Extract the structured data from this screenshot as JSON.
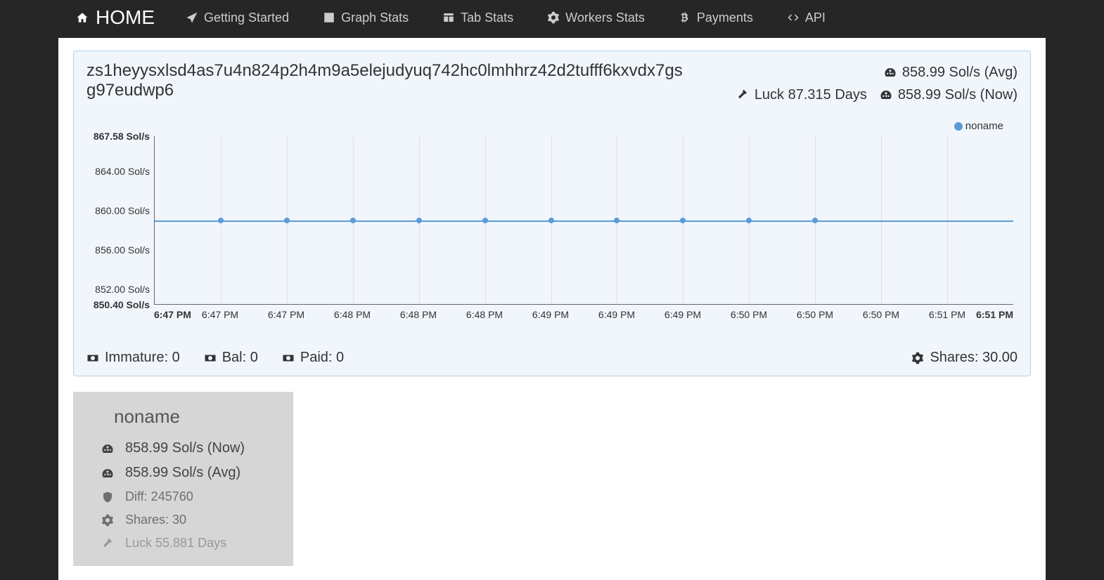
{
  "nav": {
    "home": "HOME",
    "items": [
      {
        "label": "Getting Started"
      },
      {
        "label": "Graph Stats"
      },
      {
        "label": "Tab Stats"
      },
      {
        "label": "Workers Stats"
      },
      {
        "label": "Payments"
      },
      {
        "label": "API"
      }
    ]
  },
  "panel": {
    "address": "zs1heyysxlsd4as7u4n824p2h4m9a5elejudyuq742hc0lmhhrz42d2tufff6kxvdx7gsg97eudwp6",
    "avg": "858.99 Sol/s (Avg)",
    "luck": "Luck 87.315 Days",
    "now": "858.99 Sol/s (Now)",
    "legend": "noname",
    "foot": {
      "immature": "Immature: 0",
      "bal": "Bal: 0",
      "paid": "Paid: 0",
      "shares": "Shares: 30.00"
    }
  },
  "worker": {
    "name": "noname",
    "now": "858.99 Sol/s (Now)",
    "avg": "858.99 Sol/s (Avg)",
    "diff": "Diff: 245760",
    "shares": "Shares: 30",
    "luck": "Luck 55.881 Days"
  },
  "chart_data": {
    "type": "line",
    "title": "",
    "xlabel": "",
    "ylabel": "",
    "ylim": [
      850.4,
      867.58
    ],
    "y_ticks": [
      {
        "label": "867.58 Sol/s",
        "value": 867.58,
        "bold": true
      },
      {
        "label": "864.00 Sol/s",
        "value": 864.0,
        "bold": false
      },
      {
        "label": "860.00 Sol/s",
        "value": 860.0,
        "bold": false
      },
      {
        "label": "856.00 Sol/s",
        "value": 856.0,
        "bold": false
      },
      {
        "label": "852.00 Sol/s",
        "value": 852.0,
        "bold": false
      },
      {
        "label": "850.40 Sol/s",
        "value": 850.4,
        "bold": true
      }
    ],
    "x_ticks": [
      "6:47 PM",
      "6:47 PM",
      "6:47 PM",
      "6:48 PM",
      "6:48 PM",
      "6:48 PM",
      "6:49 PM",
      "6:49 PM",
      "6:49 PM",
      "6:50 PM",
      "6:50 PM",
      "6:50 PM",
      "6:51 PM",
      "6:51 PM"
    ],
    "series": [
      {
        "name": "noname",
        "color": "#5b9bd5",
        "values": [
          858.99,
          858.99,
          858.99,
          858.99,
          858.99,
          858.99,
          858.99,
          858.99,
          858.99,
          858.99,
          858.99,
          858.99,
          858.99,
          858.99
        ]
      }
    ],
    "point_indices": [
      1,
      2,
      3,
      4,
      5,
      6,
      7,
      8,
      9,
      10
    ]
  }
}
